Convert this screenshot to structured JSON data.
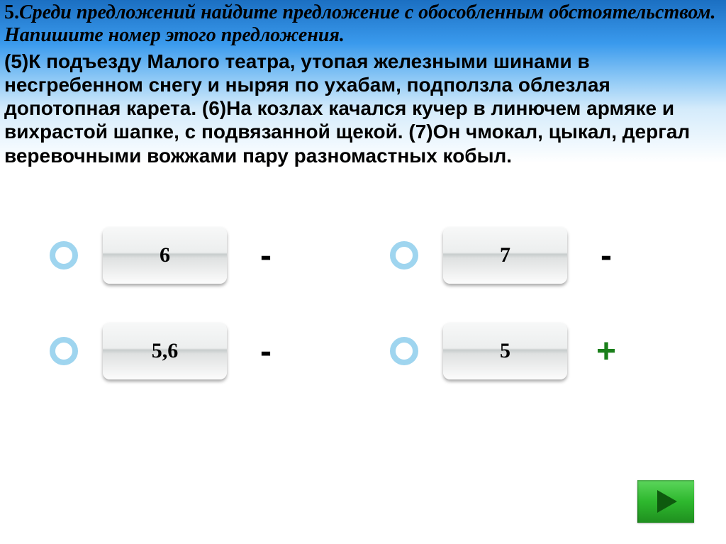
{
  "question": {
    "number_prefix": "5.",
    "prompt": "Среди предложений найдите предложение с обособленным обстоятельством. Напишите номер этого предложения.",
    "text": "(5)К подъезду Малого театра, утопая железными шинами в несгребенном снегу и ныряя по ухабам, подползла облезлая допотопная карета. (6)На козлах качался кучер в линючем армяке и вихрастой шапке, с подвязанной щекой. (7)Он чмокал, цыкал, дергал веревочными вожжами пару разномастных кобыл."
  },
  "answers": [
    {
      "label": "6",
      "result": "-",
      "correct": false
    },
    {
      "label": "7",
      "result": "-",
      "correct": false
    },
    {
      "label": "5,6",
      "result": "-",
      "correct": false
    },
    {
      "label": "5",
      "result": "+",
      "correct": true
    }
  ],
  "next_button": "next"
}
